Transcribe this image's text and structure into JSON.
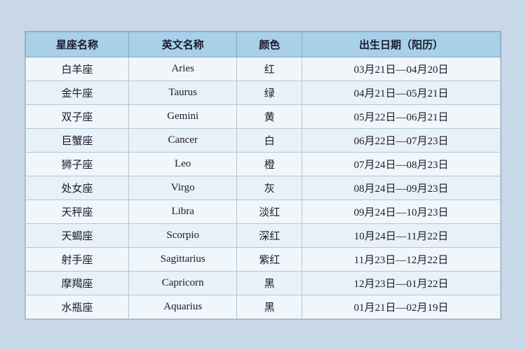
{
  "table": {
    "headers": [
      "星座名称",
      "英文名称",
      "颜色",
      "出生日期（阳历）"
    ],
    "rows": [
      {
        "chinese": "白羊座",
        "english": "Aries",
        "color": "红",
        "dates": "03月21日—04月20日"
      },
      {
        "chinese": "金牛座",
        "english": "Taurus",
        "color": "绿",
        "dates": "04月21日—05月21日"
      },
      {
        "chinese": "双子座",
        "english": "Gemini",
        "color": "黄",
        "dates": "05月22日—06月21日"
      },
      {
        "chinese": "巨蟹座",
        "english": "Cancer",
        "color": "白",
        "dates": "06月22日—07月23日"
      },
      {
        "chinese": "狮子座",
        "english": "Leo",
        "color": "橙",
        "dates": "07月24日—08月23日"
      },
      {
        "chinese": "处女座",
        "english": "Virgo",
        "color": "灰",
        "dates": "08月24日—09月23日"
      },
      {
        "chinese": "天秤座",
        "english": "Libra",
        "color": "淡红",
        "dates": "09月24日—10月23日"
      },
      {
        "chinese": "天蝎座",
        "english": "Scorpio",
        "color": "深红",
        "dates": "10月24日—11月22日"
      },
      {
        "chinese": "射手座",
        "english": "Sagittarius",
        "color": "紫红",
        "dates": "11月23日—12月22日"
      },
      {
        "chinese": "摩羯座",
        "english": "Capricorn",
        "color": "黑",
        "dates": "12月23日—01月22日"
      },
      {
        "chinese": "水瓶座",
        "english": "Aquarius",
        "color": "黑",
        "dates": "01月21日—02月19日"
      }
    ]
  }
}
